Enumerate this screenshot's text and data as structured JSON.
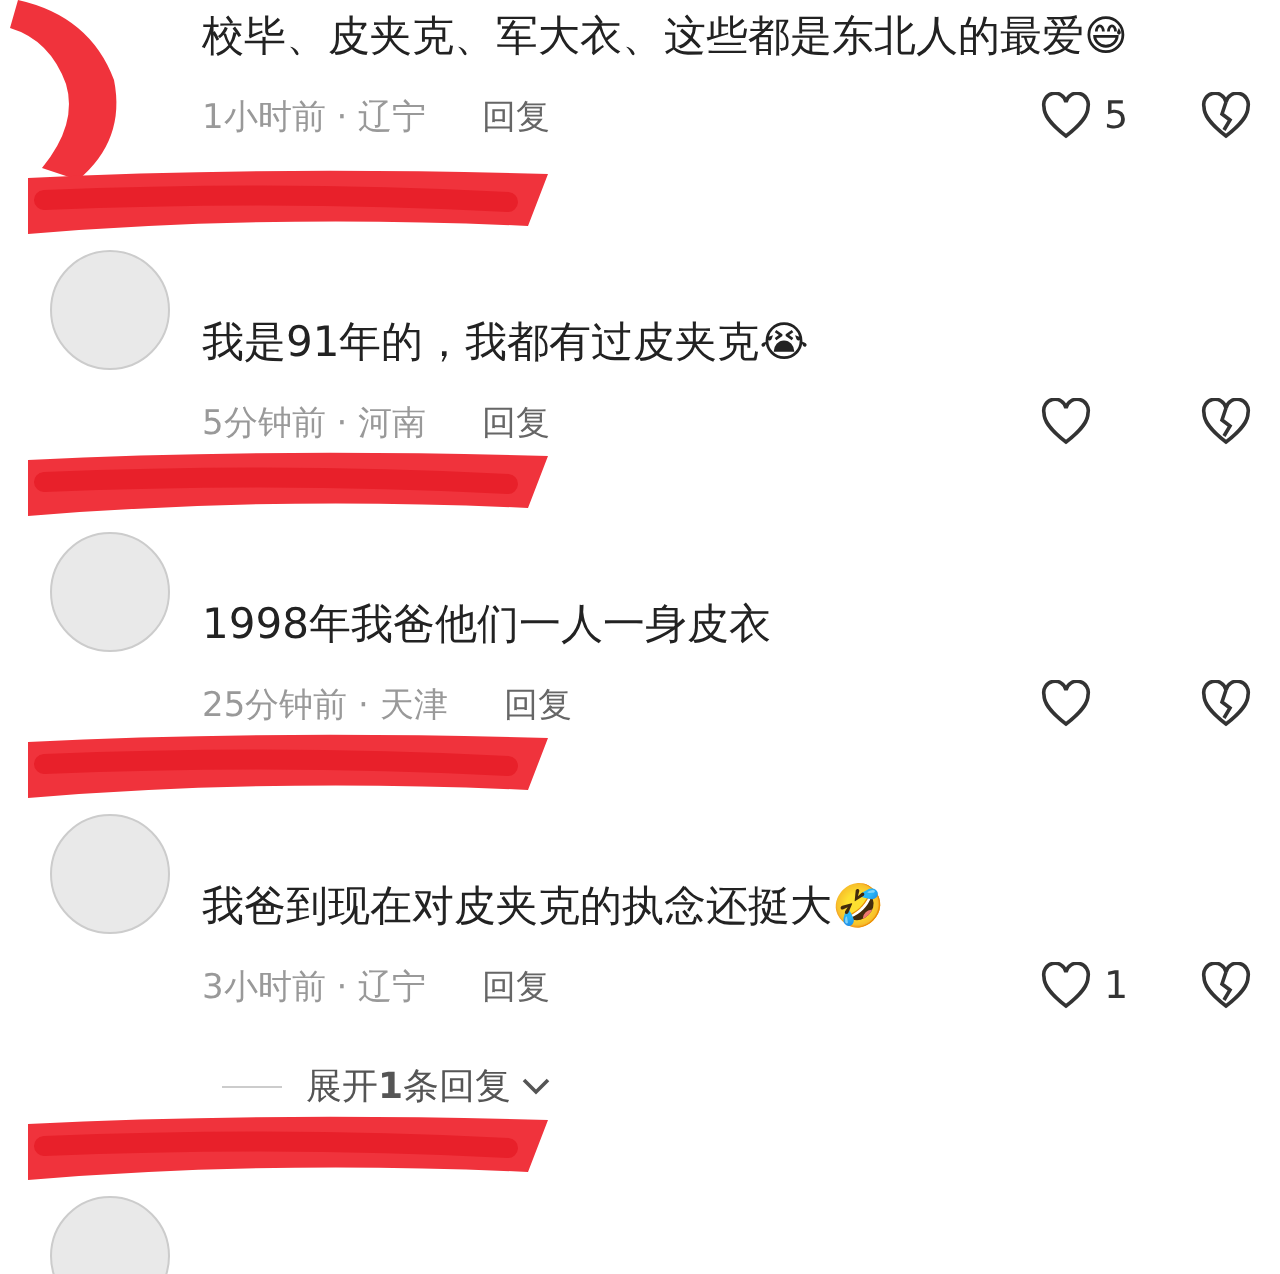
{
  "comments": [
    {
      "kind": "covered",
      "text": "校毕、皮夹克、军大衣、这些都是东北人的最爱😅",
      "time": "1小时前 · 辽宁",
      "reply": "回复",
      "likes": "5"
    },
    {
      "kind": "redacted",
      "text": "我是91年的，我都有过皮夹克😭",
      "time": "5分钟前 · 河南",
      "reply": "回复"
    },
    {
      "kind": "redacted",
      "text": "1998年我爸他们一人一身皮衣",
      "time": "25分钟前 · 天津",
      "reply": "回复"
    },
    {
      "kind": "redacted",
      "text": "我爸到现在对皮夹克的执念还挺大🤣",
      "time": "3小时前 · 辽宁",
      "reply": "回复",
      "likes": "1",
      "expand": "展开**1**条回复"
    },
    {
      "kind": "redacted"
    }
  ]
}
